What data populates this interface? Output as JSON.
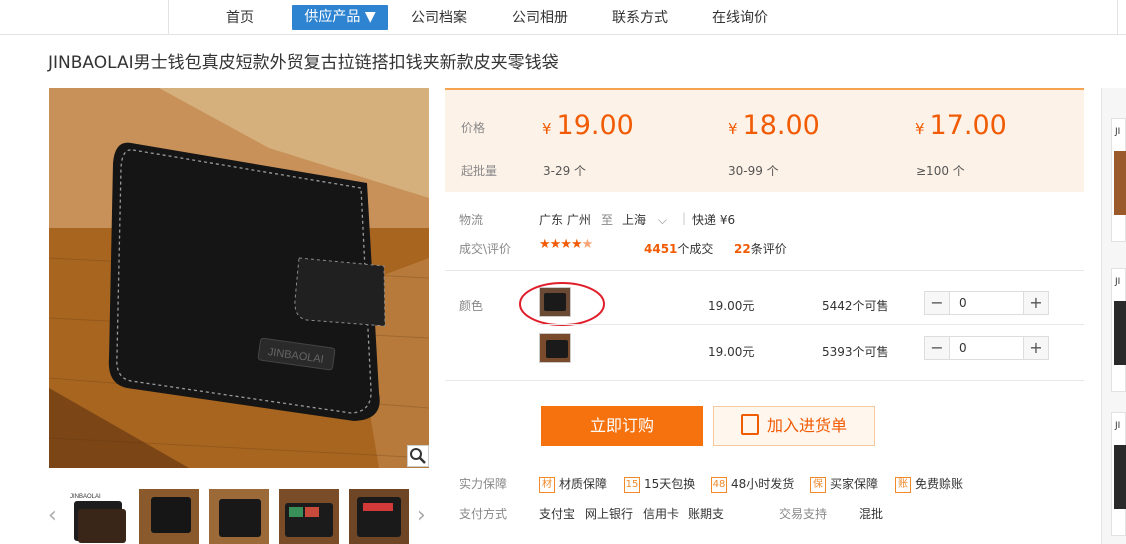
{
  "nav": {
    "items": [
      "首页",
      "供应产品",
      "公司档案",
      "公司相册",
      "联系方式",
      "在线询价"
    ],
    "active_index": 1,
    "active_color": "#2f84d2"
  },
  "product": {
    "title": "JINBAOLAI男士钱包真皮短款外贸复古拉链搭扣钱夹新款皮夹零钱袋",
    "main_image_brand": "JINBAOLAI",
    "thumb_brand": "JINBAOLAI"
  },
  "pricing": {
    "price_label": "价格",
    "qty_label": "起批量",
    "currency": "¥",
    "tiers": [
      {
        "price": "19.00",
        "qty": "3-29 个"
      },
      {
        "price": "18.00",
        "qty": "30-99 个"
      },
      {
        "price": "17.00",
        "qty": "≥100 个"
      }
    ],
    "accent": "#f05b04"
  },
  "logistics": {
    "label": "物流",
    "from": "广东 广州",
    "to_word": "至",
    "to": "上海",
    "shipping": "快递 ¥6"
  },
  "deals": {
    "label": "成交\\评价",
    "stars": 4.5,
    "deal_count": "4451",
    "deal_suffix": "个成交",
    "review_count": "22",
    "review_suffix": "条评价"
  },
  "color": {
    "label": "颜色",
    "options": [
      {
        "price": "19.00元",
        "stock": "5442个可售",
        "qty": "0",
        "selected": true
      },
      {
        "price": "19.00元",
        "stock": "5393个可售",
        "qty": "0",
        "selected": false
      }
    ]
  },
  "actions": {
    "buy": "立即订购",
    "cart": "加入进货单"
  },
  "guarantee": {
    "label": "实力保障",
    "items": [
      {
        "icon": "材",
        "text": "材质保障"
      },
      {
        "icon": "15",
        "text": "15天包换"
      },
      {
        "icon": "48",
        "text": "48小时发货"
      },
      {
        "icon": "保",
        "text": "买家保障"
      },
      {
        "icon": "账",
        "text": "免费赊账"
      }
    ]
  },
  "payment": {
    "label": "支付方式",
    "methods": [
      "支付宝",
      "网上银行",
      "信用卡",
      "账期支"
    ],
    "trade_label": "交易支持",
    "trade_value": "混批"
  },
  "rail": {
    "labels": [
      "JI",
      "JI",
      "JI"
    ]
  }
}
